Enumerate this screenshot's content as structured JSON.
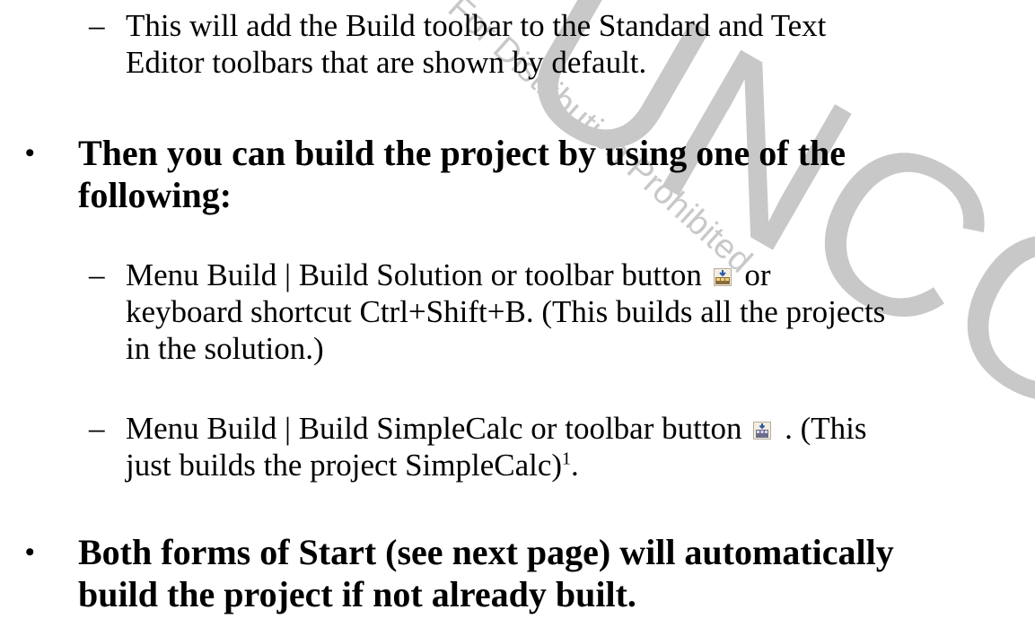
{
  "watermark": {
    "big": "UNCOPY",
    "small": "For Distribution Prohibited"
  },
  "items": {
    "sub1": {
      "dash": "–",
      "line1": "This will add the Build toolbar to the Standard and Text",
      "line2": "Editor toolbars that are shown by default."
    },
    "bullet1": {
      "dot": "•",
      "line1": "Then you can build the project by using one of the",
      "line2": "following:"
    },
    "sub2": {
      "dash": "–",
      "line1_a": "Menu Build | Build Solution or toolbar button",
      "line1_b": "or",
      "line2": "keyboard shortcut Ctrl+Shift+B. (This builds all the projects",
      "line3": "in the solution.)"
    },
    "sub3": {
      "dash": "–",
      "line1_a": "Menu Build | Build SimpleCalc or toolbar button",
      "line1_b": ". (This",
      "line2_a": "just builds the project SimpleCalc)",
      "footnote": "1",
      "line2_b": "."
    },
    "bullet2": {
      "dot": "•",
      "line1": "Both forms of Start (see next page) will automatically",
      "line2": "build the project if not already built."
    }
  },
  "icons": {
    "build_solution": "build-solution-icon",
    "build_project": "build-project-icon"
  }
}
